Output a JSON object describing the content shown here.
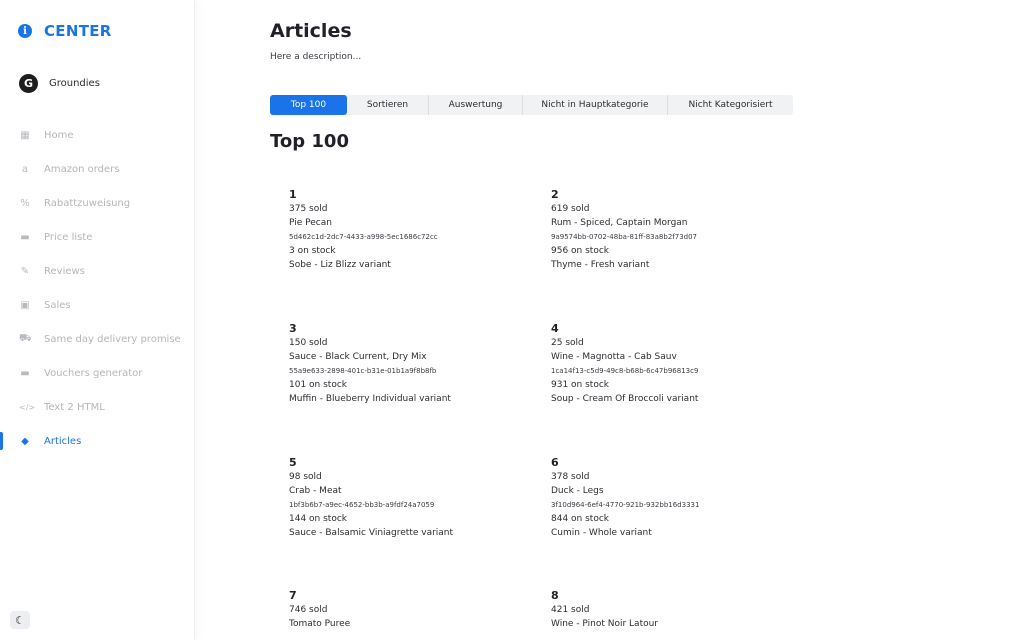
{
  "brand": {
    "title": "CENTER",
    "icon": "info-icon",
    "color": "#1a73e8"
  },
  "user": {
    "name": "Groundies",
    "avatar_letter": "G"
  },
  "nav": [
    {
      "label": "Home",
      "icon": "grid-icon",
      "glyph": "▦",
      "active": false
    },
    {
      "label": "Amazon orders",
      "icon": "amazon-icon",
      "glyph": "a",
      "active": false
    },
    {
      "label": "Rabattzuweisung",
      "icon": "percent-icon",
      "glyph": "%",
      "active": false
    },
    {
      "label": "Price liste",
      "icon": "card-icon",
      "glyph": "▬",
      "active": false
    },
    {
      "label": "Reviews",
      "icon": "edit-icon",
      "glyph": "✎",
      "active": false
    },
    {
      "label": "Sales",
      "icon": "chart-icon",
      "glyph": "▣",
      "active": false
    },
    {
      "label": "Same day delivery promise",
      "icon": "truck-icon",
      "glyph": "⛟",
      "active": false
    },
    {
      "label": "Vouchers generator",
      "icon": "voucher-icon",
      "glyph": "▬",
      "active": false
    },
    {
      "label": "Text 2 HTML",
      "icon": "code-icon",
      "glyph": "</>",
      "active": false
    },
    {
      "label": "Articles",
      "icon": "shapes-icon",
      "glyph": "◆",
      "active": true
    }
  ],
  "theme_toggle": {
    "icon": "moon-icon",
    "glyph": "☾"
  },
  "page": {
    "title": "Articles",
    "description": "Here a description..."
  },
  "tabs": [
    {
      "label": "Top 100",
      "active": true
    },
    {
      "label": "Sortieren",
      "active": false
    },
    {
      "label": "Auswertung",
      "active": false
    },
    {
      "label": "Nicht in Hauptkategorie",
      "active": false
    },
    {
      "label": "Nicht Kategorisiert",
      "active": false
    }
  ],
  "section_title": "Top 100",
  "articles": [
    {
      "rank": "1",
      "sold": "375 sold",
      "name": "Pie Pecan",
      "uuid": "5d462c1d-2dc7-4433-a998-5ec1686c72cc",
      "stock": "3 on stock",
      "variant": "Sobe - Liz Blizz variant"
    },
    {
      "rank": "2",
      "sold": "619 sold",
      "name": "Rum - Spiced, Captain Morgan",
      "uuid": "9a9574bb-0702-48ba-81ff-83a8b2f73d07",
      "stock": "956 on stock",
      "variant": "Thyme - Fresh variant"
    },
    {
      "rank": "3",
      "sold": "150 sold",
      "name": "Sauce - Black Current, Dry Mix",
      "uuid": "55a9e633-2898-401c-b31e-01b1a9f8b8fb",
      "stock": "101 on stock",
      "variant": "Muffin - Blueberry Individual variant"
    },
    {
      "rank": "4",
      "sold": "25 sold",
      "name": "Wine - Magnotta - Cab Sauv",
      "uuid": "1ca14f13-c5d9-49c8-b68b-6c47b96813c9",
      "stock": "931 on stock",
      "variant": "Soup - Cream Of Broccoli variant"
    },
    {
      "rank": "5",
      "sold": "98 sold",
      "name": "Crab - Meat",
      "uuid": "1bf3b6b7-a9ec-4652-bb3b-a9fdf24a7059",
      "stock": "144 on stock",
      "variant": "Sauce - Balsamic Viniagrette variant"
    },
    {
      "rank": "6",
      "sold": "378 sold",
      "name": "Duck - Legs",
      "uuid": "3f10d964-6ef4-4770-921b-932bb16d3331",
      "stock": "844 on stock",
      "variant": "Cumin - Whole variant"
    },
    {
      "rank": "7",
      "sold": "746 sold",
      "name": "Tomato Puree",
      "uuid": "",
      "stock": "",
      "variant": ""
    },
    {
      "rank": "8",
      "sold": "421 sold",
      "name": "Wine - Pinot Noir Latour",
      "uuid": "",
      "stock": "",
      "variant": ""
    }
  ]
}
